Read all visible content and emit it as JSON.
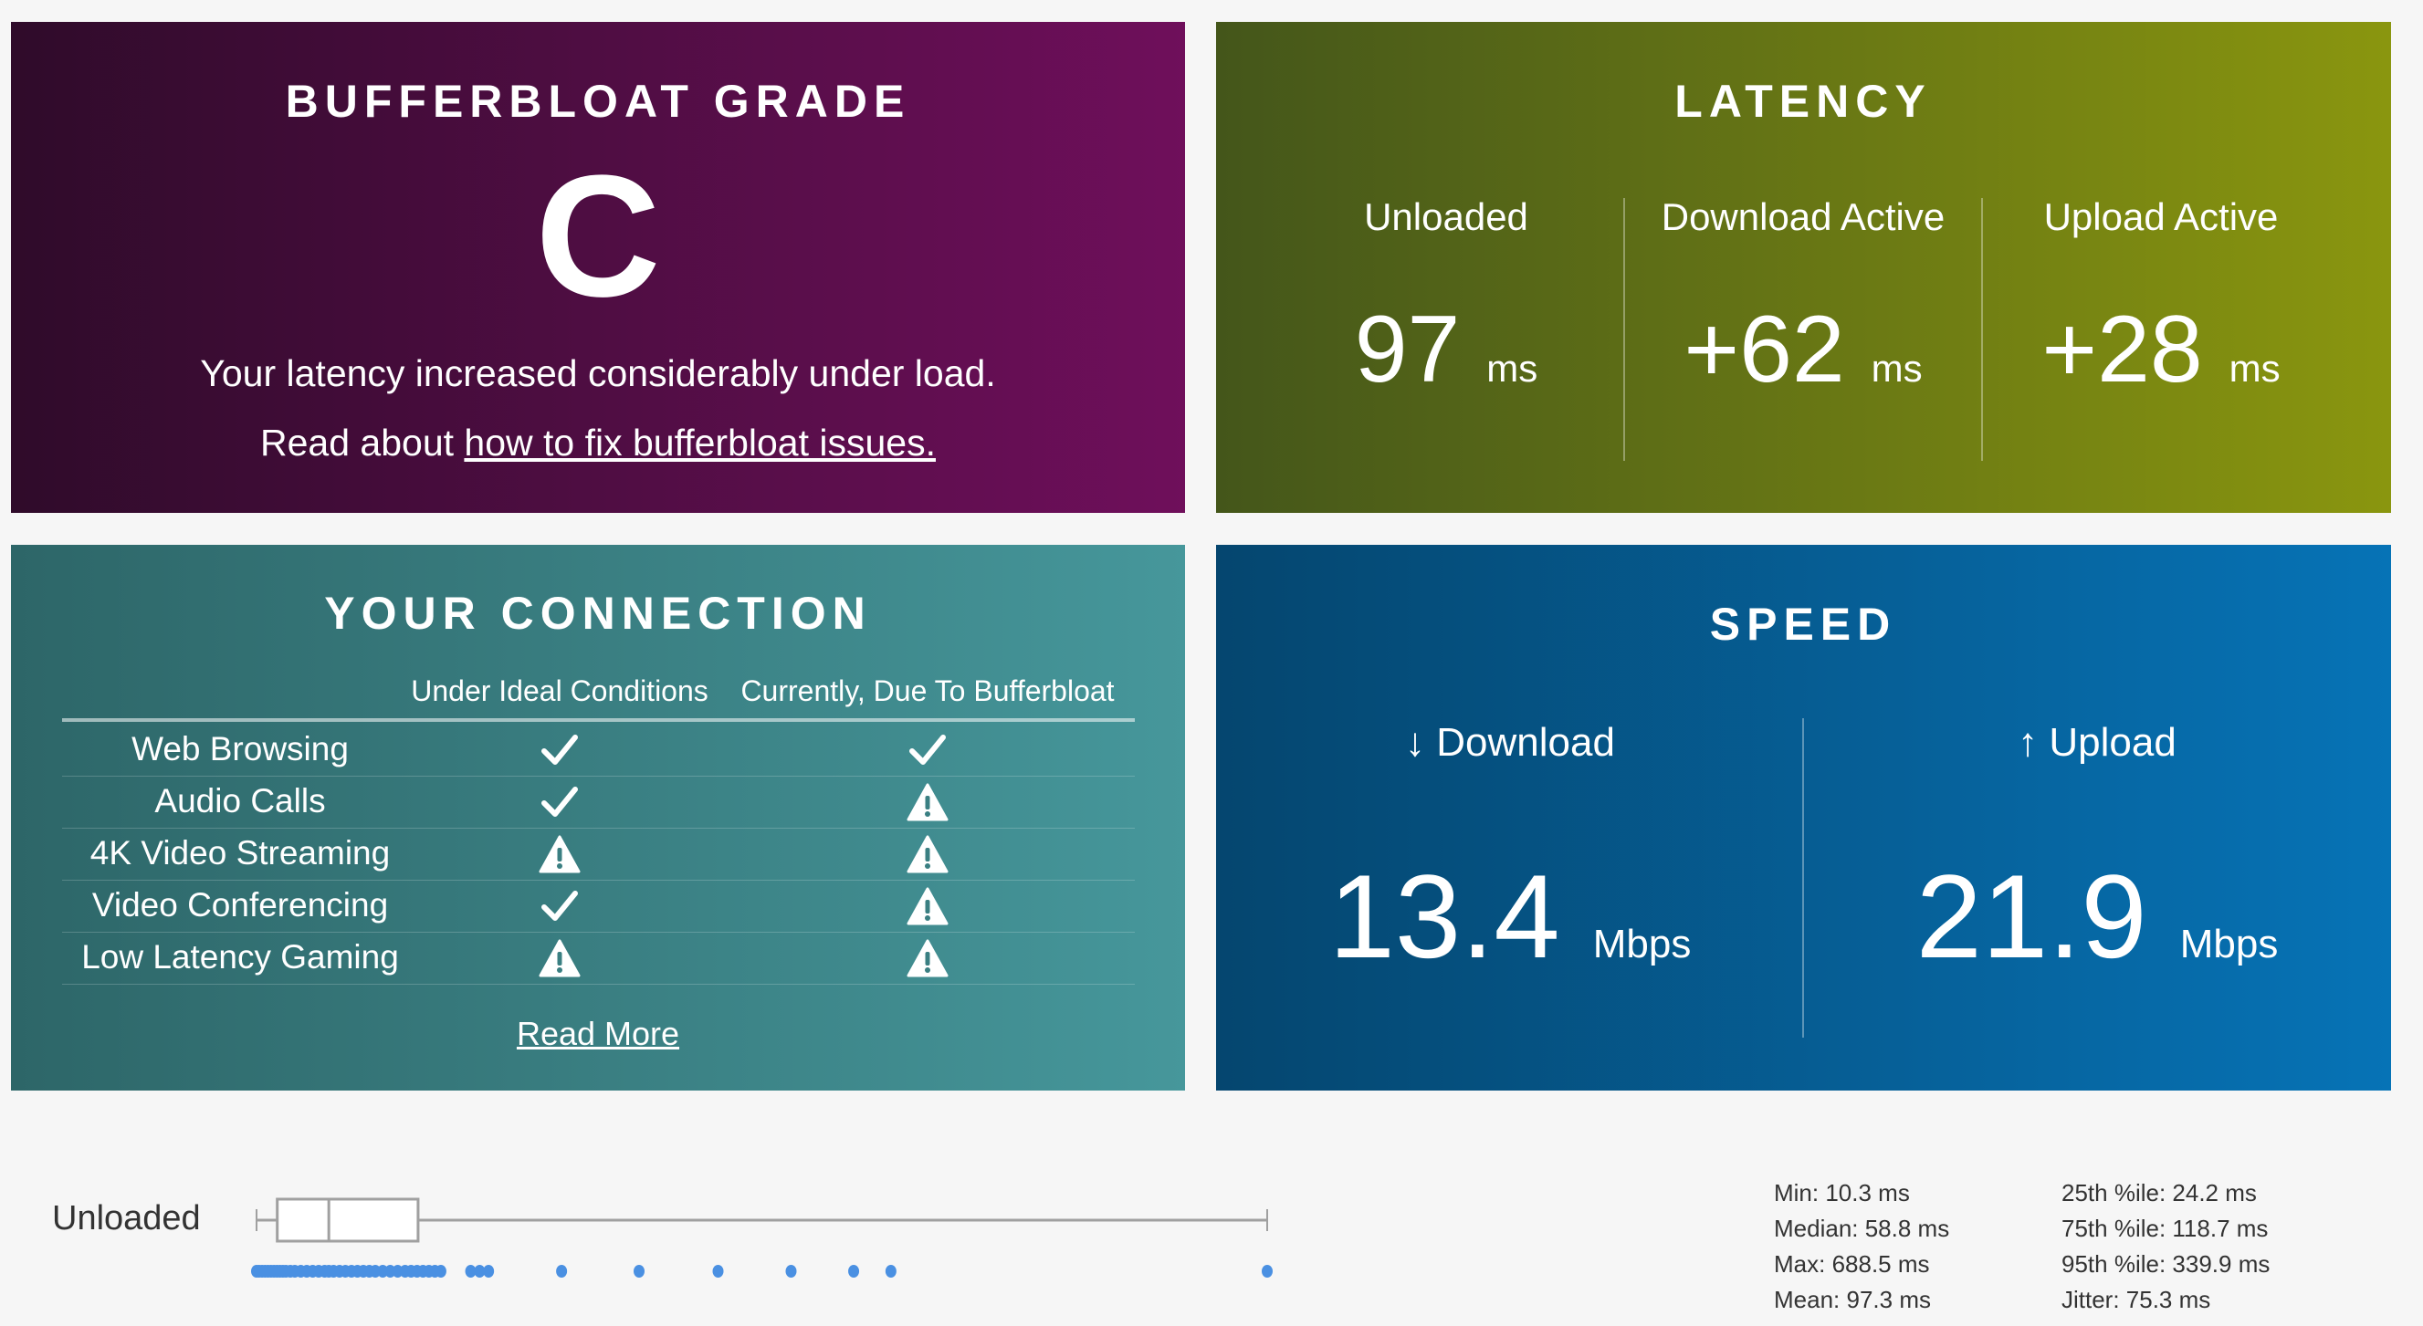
{
  "grade": {
    "title": "BUFFERBLOAT GRADE",
    "letter": "C",
    "message": "Your latency increased considerably under load.",
    "read_prefix": "Read about ",
    "link": "how to fix bufferbloat issues."
  },
  "latency": {
    "title": "LATENCY",
    "columns": [
      {
        "label": "Unloaded",
        "value": "97",
        "unit": "ms"
      },
      {
        "label": "Download Active",
        "value": "+62",
        "unit": "ms"
      },
      {
        "label": "Upload Active",
        "value": "+28",
        "unit": "ms"
      }
    ]
  },
  "connection": {
    "title": "YOUR CONNECTION",
    "headers": [
      "Under Ideal Conditions",
      "Currently, Due To Bufferbloat"
    ],
    "rows": [
      {
        "label": "Web Browsing",
        "ideal": "check",
        "current": "check"
      },
      {
        "label": "Audio Calls",
        "ideal": "check",
        "current": "warning"
      },
      {
        "label": "4K Video Streaming",
        "ideal": "warning",
        "current": "warning"
      },
      {
        "label": "Video Conferencing",
        "ideal": "check",
        "current": "warning"
      },
      {
        "label": "Low Latency Gaming",
        "ideal": "warning",
        "current": "warning"
      }
    ],
    "read_more": "Read More"
  },
  "speed": {
    "title": "SPEED",
    "download": {
      "label": "↓ Download",
      "value": "13.4",
      "unit": "Mbps"
    },
    "upload": {
      "label": "↑ Upload",
      "value": "21.9",
      "unit": "Mbps"
    }
  },
  "unloaded_plot": {
    "label": "Unloaded",
    "colors": {
      "points": "#4a90e2",
      "box": "#a0a0a0"
    },
    "box": {
      "min": 10.3,
      "q1": 24.2,
      "median": 58.8,
      "q3": 118.7,
      "max": 688.5
    },
    "points": [
      10.3,
      12,
      14,
      16,
      18,
      20,
      22,
      24,
      26,
      28,
      30,
      33,
      36,
      40,
      44,
      48,
      52,
      56,
      58.8,
      62,
      66,
      70,
      74,
      78,
      82,
      86,
      90,
      95,
      100,
      105,
      110,
      114,
      118,
      122,
      126,
      130,
      134,
      154,
      160,
      166,
      215,
      267,
      320,
      369,
      411,
      436,
      688.5
    ],
    "stats_left": [
      "Min: 10.3 ms",
      "Median: 58.8 ms",
      "Max: 688.5 ms",
      "Mean: 97.3 ms"
    ],
    "stats_right": [
      "25th %ile: 24.2 ms",
      "75th %ile: 118.7 ms",
      "95th %ile: 339.9 ms",
      "Jitter: 75.3 ms"
    ]
  }
}
